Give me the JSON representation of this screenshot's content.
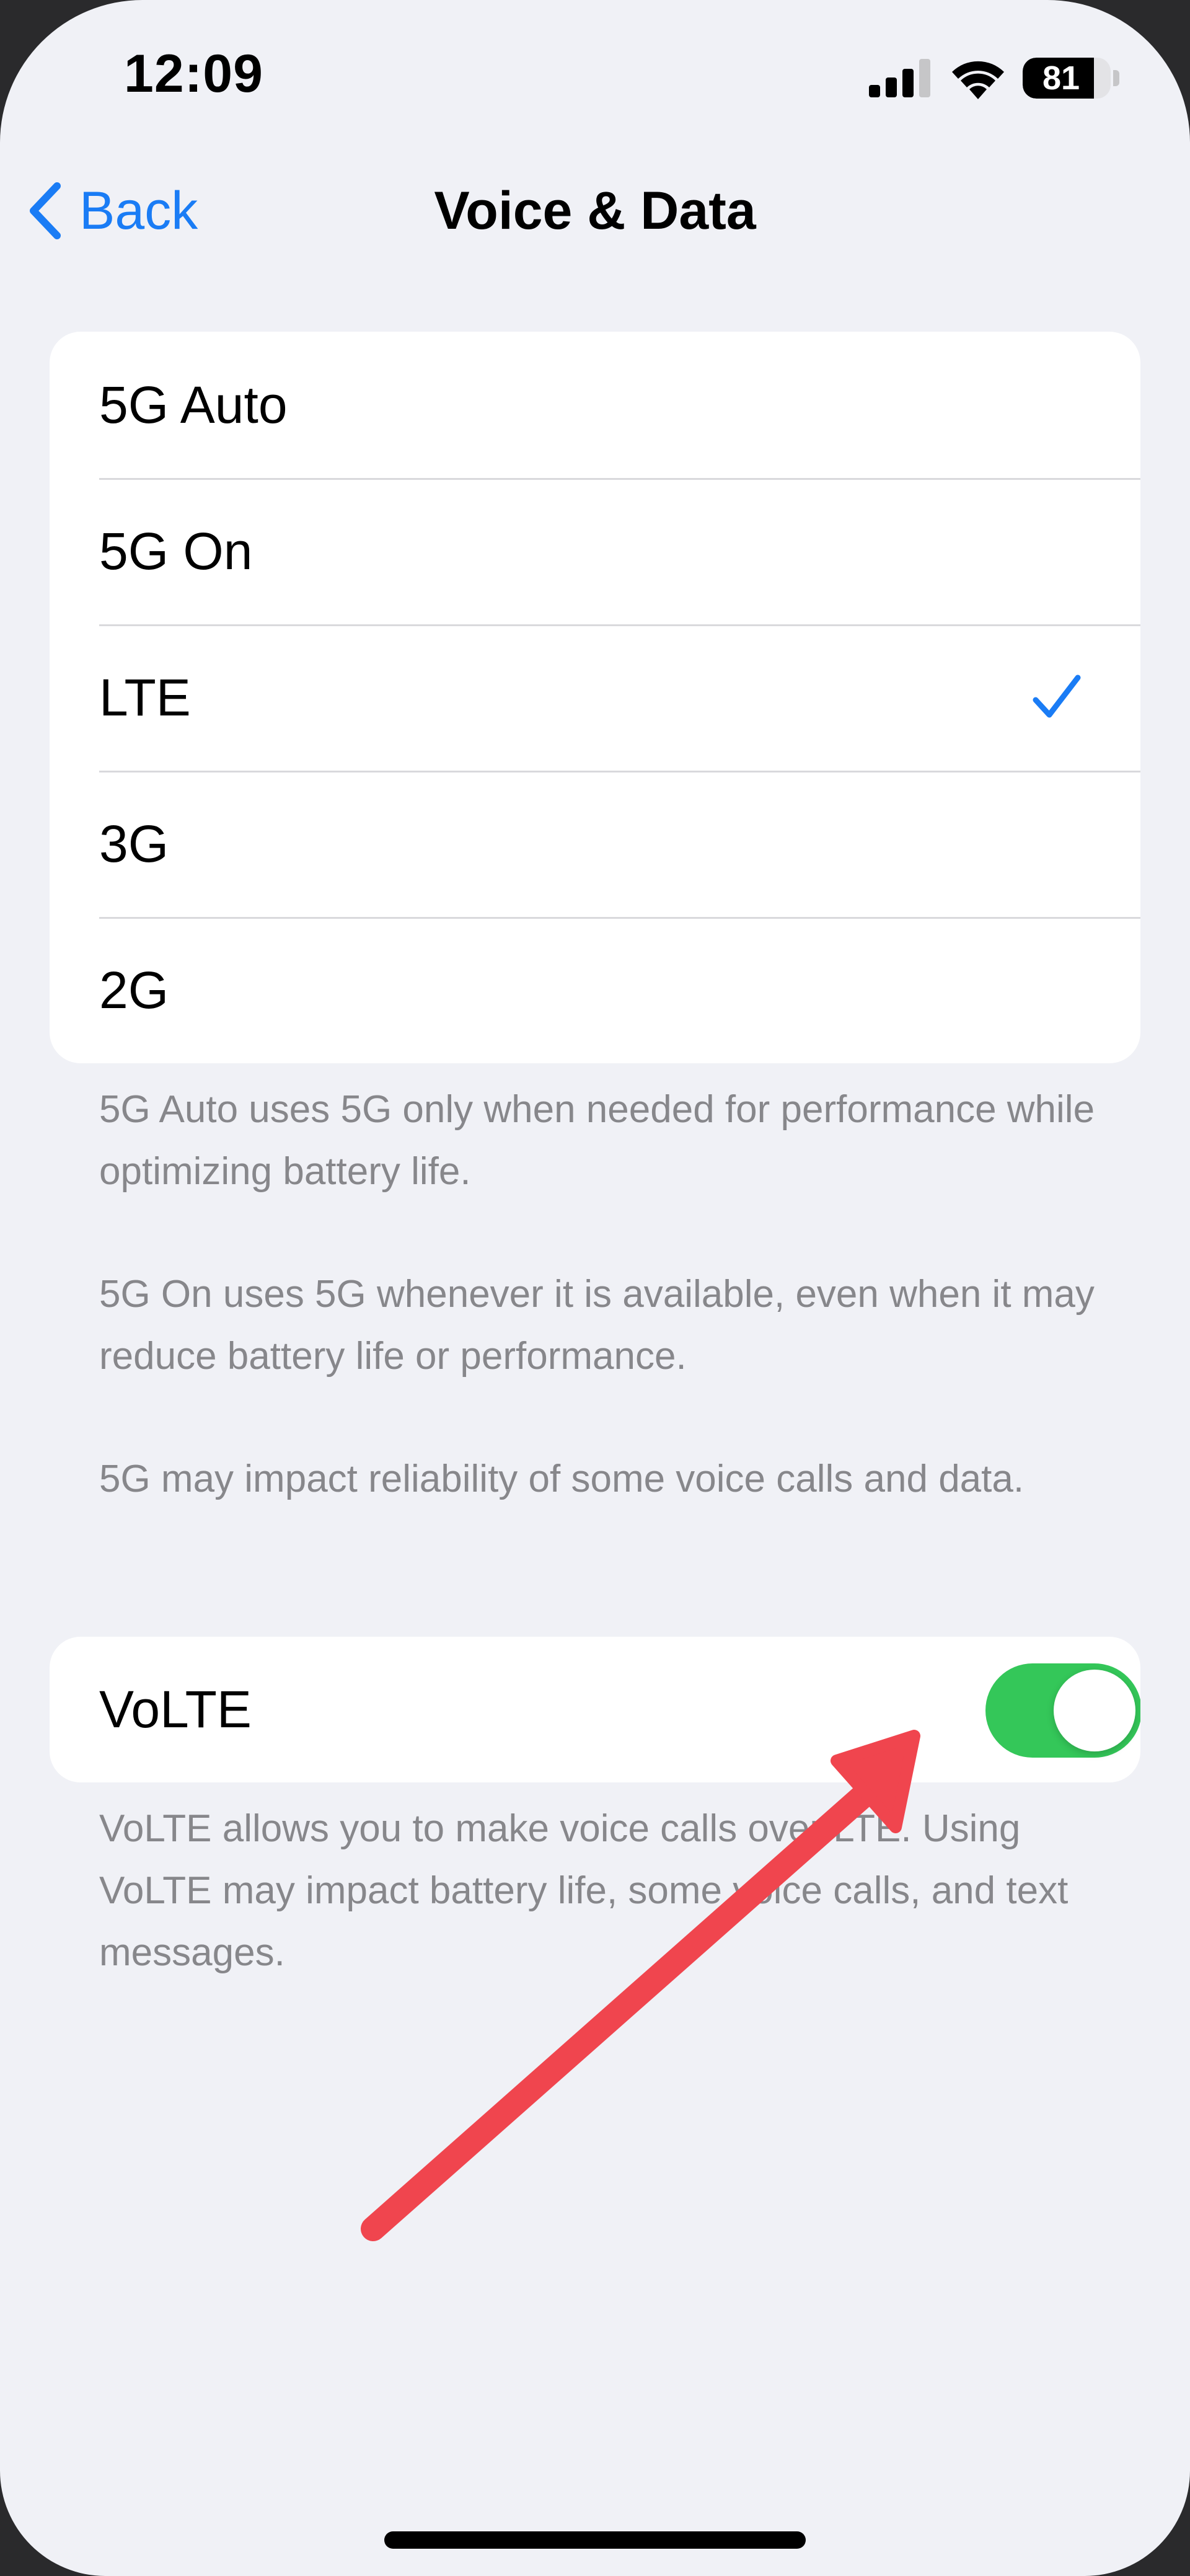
{
  "status_bar": {
    "time": "12:09",
    "battery_level": "81",
    "battery_fraction": 0.81,
    "icons": [
      "cellular-signal-icon",
      "wifi-icon",
      "battery-icon"
    ]
  },
  "nav": {
    "back_label": "Back",
    "title": "Voice & Data"
  },
  "options": [
    {
      "label": "5G Auto",
      "selected": false
    },
    {
      "label": "5G On",
      "selected": false
    },
    {
      "label": "LTE",
      "selected": true
    },
    {
      "label": "3G",
      "selected": false
    },
    {
      "label": "2G",
      "selected": false
    }
  ],
  "footnotes": [
    "5G Auto uses 5G only when needed for performance while optimizing battery life.",
    "5G On uses 5G whenever it is available, even when it may reduce battery life or performance.",
    "5G may impact reliability of some voice calls and data."
  ],
  "volte": {
    "label": "VoLTE",
    "enabled": true,
    "footnote": "VoLTE allows you to make voice calls over LTE. Using VoLTE may impact battery life, some voice calls, and text messages."
  },
  "colors": {
    "accent": "#1a7cf5",
    "toggle_on": "#34c759",
    "annotation_arrow": "#f0454e",
    "background": "#f0f1f6"
  }
}
